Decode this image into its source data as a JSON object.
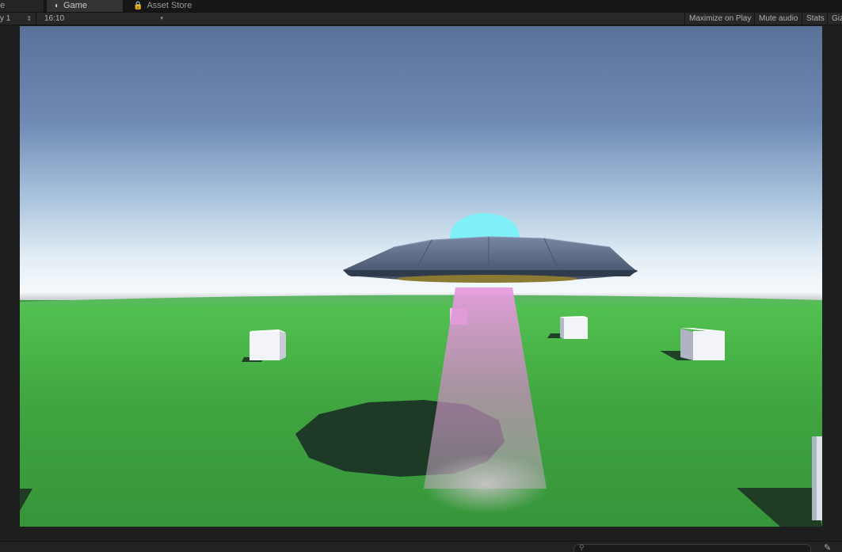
{
  "tabs": {
    "scene": {
      "label": "ne",
      "icon": "scene-icon"
    },
    "game": {
      "label": "Game",
      "icon": "pacman-game-icon"
    },
    "asset_store": {
      "label": "Asset Store",
      "icon": "lock-bag-icon"
    }
  },
  "toolbar": {
    "display": {
      "value": "y 1",
      "icon": "up-down-arrows-icon"
    },
    "aspect": {
      "value": "16:10",
      "icon": "dropdown-arrow-icon"
    },
    "maximize_on_play": "Maximize on Play",
    "mute_audio": "Mute audio",
    "stats": "Stats",
    "gizmos": "Giz"
  },
  "scene": {
    "sky_top": "#5a7299",
    "sky_horizon": "#f4f8fb",
    "ground": "#3d9f3f",
    "ufo_body": "#5d6a84",
    "ufo_dome": "#7ff0f8",
    "ufo_ring": "#8a7a32",
    "beam": "#e596d8",
    "shadow": "#1d3a27",
    "cubes": "#f2f4f7"
  },
  "bottom": {
    "search": {
      "icon": "search-icon",
      "placeholder": ""
    },
    "lock": {
      "icon": "lock-icon"
    }
  }
}
